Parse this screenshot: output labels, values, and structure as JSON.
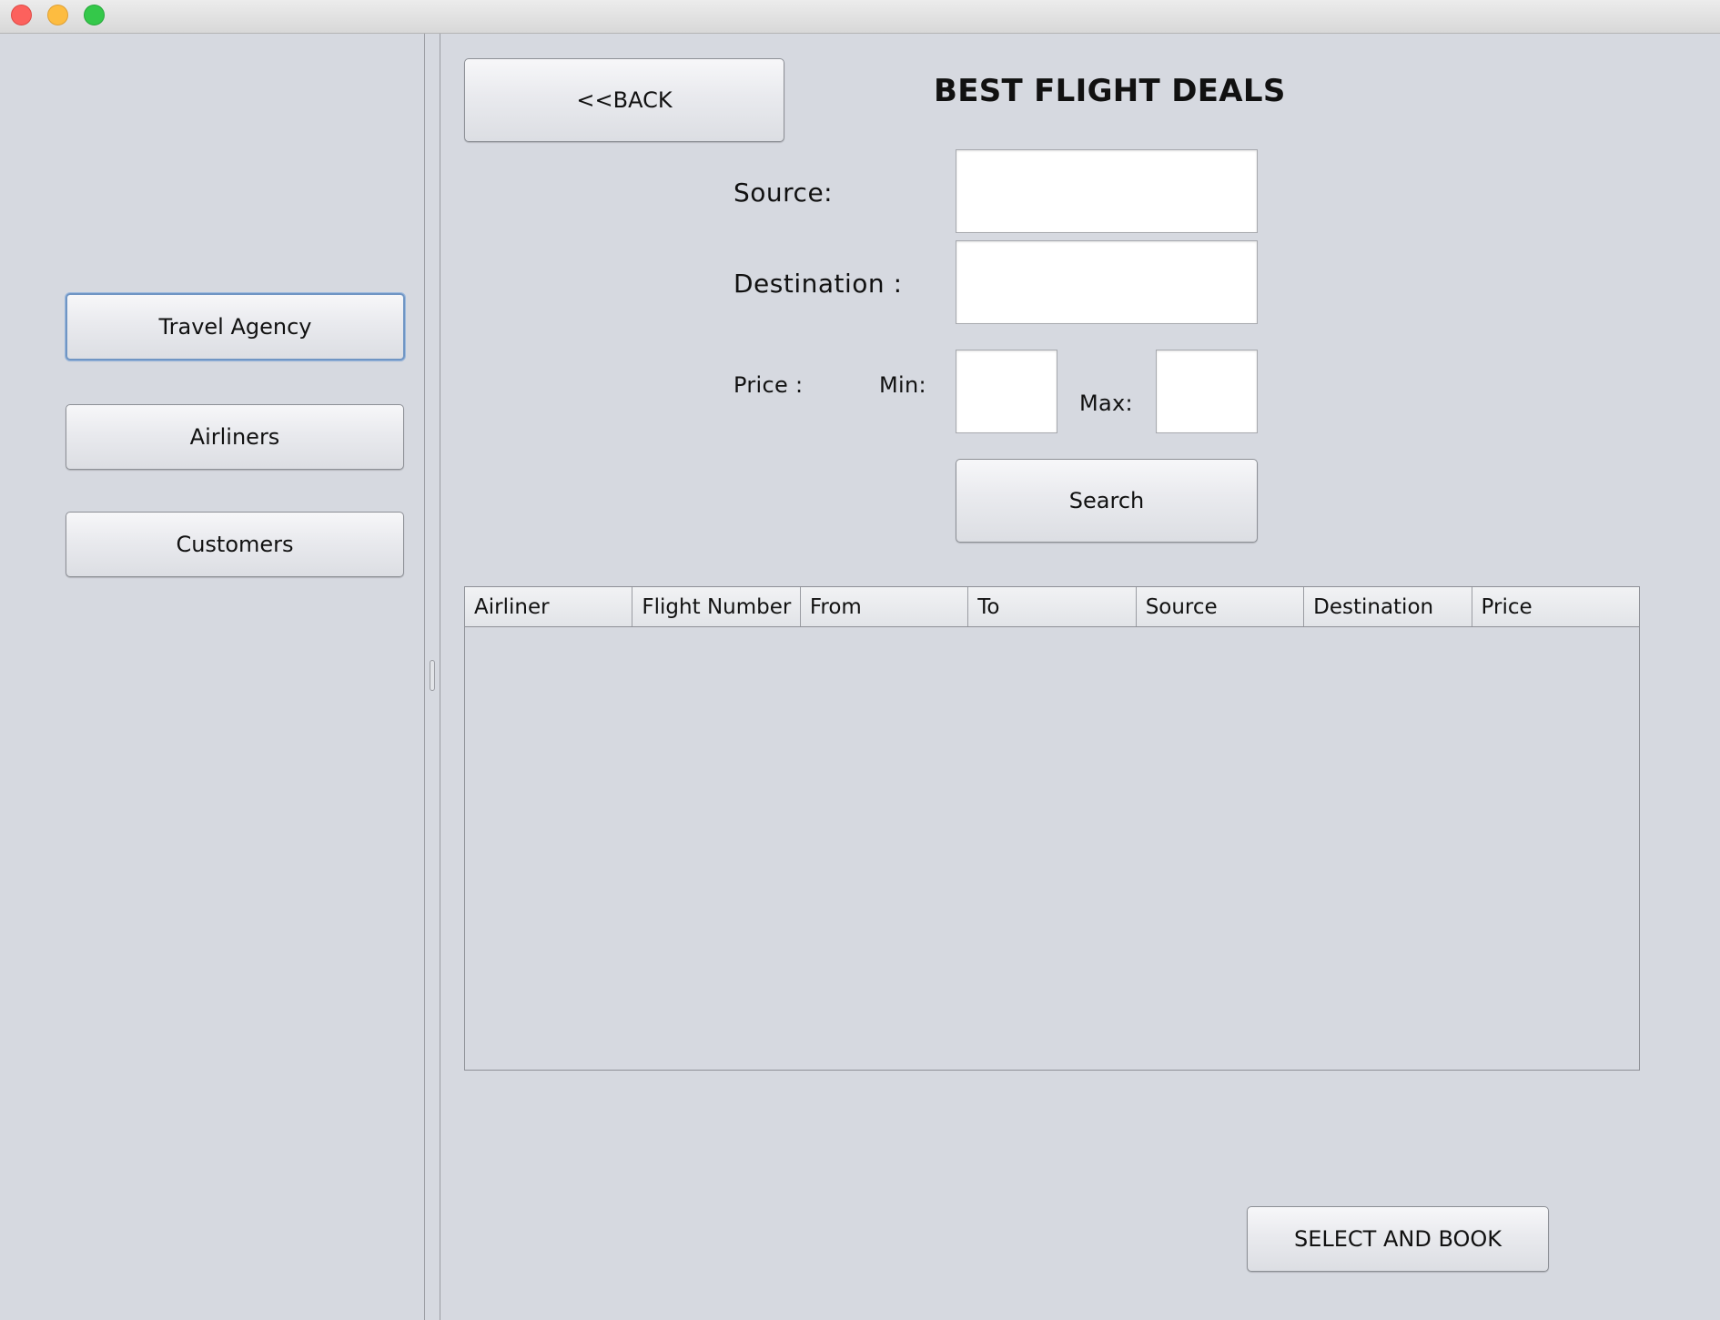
{
  "window": {
    "controls": [
      "close",
      "minimize",
      "maximize"
    ]
  },
  "sidebar": {
    "items": [
      {
        "label": "Travel Agency",
        "focused": true
      },
      {
        "label": "Airliners"
      },
      {
        "label": "Customers"
      }
    ]
  },
  "main": {
    "back_label": "<<BACK",
    "title": "BEST FLIGHT DEALS",
    "form": {
      "source_label": "Source:",
      "source_value": "",
      "destination_label": "Destination :",
      "destination_value": "",
      "price_label": "Price :",
      "min_label": "Min:",
      "min_value": "",
      "max_label": "Max:",
      "max_value": "",
      "search_label": "Search"
    },
    "table": {
      "columns": [
        "Airliner",
        "Flight Number",
        "From",
        "To",
        "Source",
        "Destination",
        "Price"
      ],
      "rows": []
    },
    "book_label": "SELECT AND BOOK"
  }
}
